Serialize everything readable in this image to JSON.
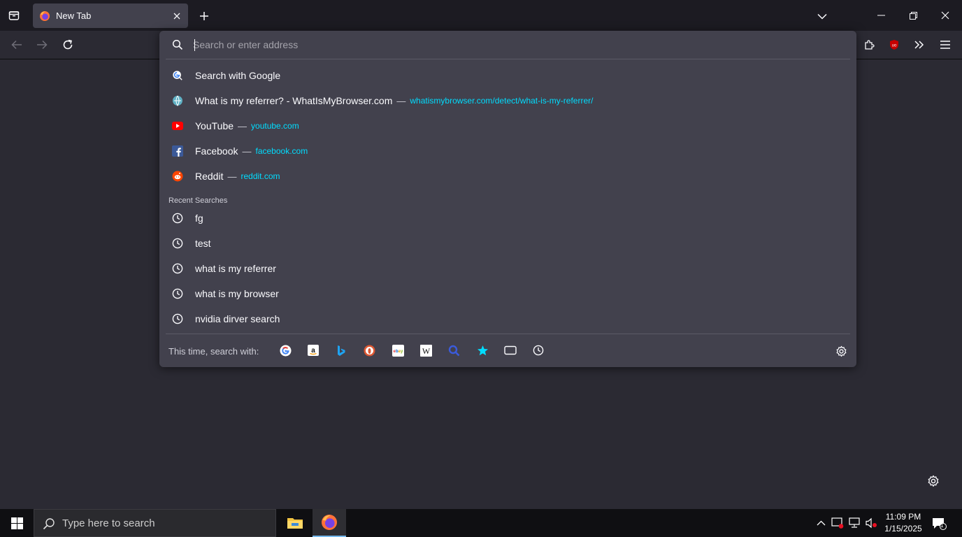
{
  "window": {
    "tab_title": "New Tab"
  },
  "urlbar": {
    "placeholder": "Search or enter address",
    "value": ""
  },
  "suggestions": [
    {
      "icon": "google-search-icon",
      "title": "Search with Google",
      "url": ""
    },
    {
      "icon": "globe-favicon-icon",
      "title": "What is my referrer? - WhatIsMyBrowser.com",
      "url": "whatismybrowser.com/detect/what-is-my-referrer/"
    },
    {
      "icon": "youtube-icon",
      "title": "YouTube",
      "url": "youtube.com"
    },
    {
      "icon": "facebook-icon",
      "title": "Facebook",
      "url": "facebook.com"
    },
    {
      "icon": "reddit-icon",
      "title": "Reddit",
      "url": "reddit.com"
    }
  ],
  "recent_searches": {
    "label": "Recent Searches",
    "items": [
      "fg",
      "test",
      "what is my referrer",
      "what is my browser",
      "nvidia dirver search"
    ]
  },
  "separator": "—",
  "footer": {
    "label": "This time, search with:",
    "engines": [
      "google-icon",
      "amazon-icon",
      "bing-icon",
      "duckduckgo-icon",
      "ebay-icon",
      "wikipedia-icon",
      "search-glass-icon",
      "bookmarks-star-icon",
      "tabs-icon",
      "history-clock-icon"
    ]
  },
  "taskbar": {
    "search_placeholder": "Type here to search",
    "time": "11:09 PM",
    "date": "1/15/2025",
    "notification_count": "1"
  },
  "colors": {
    "accent_url": "#00ddff",
    "popup_bg": "#42414d",
    "tabbar_bg": "#1c1b22",
    "page_bg": "#2b2a33"
  }
}
